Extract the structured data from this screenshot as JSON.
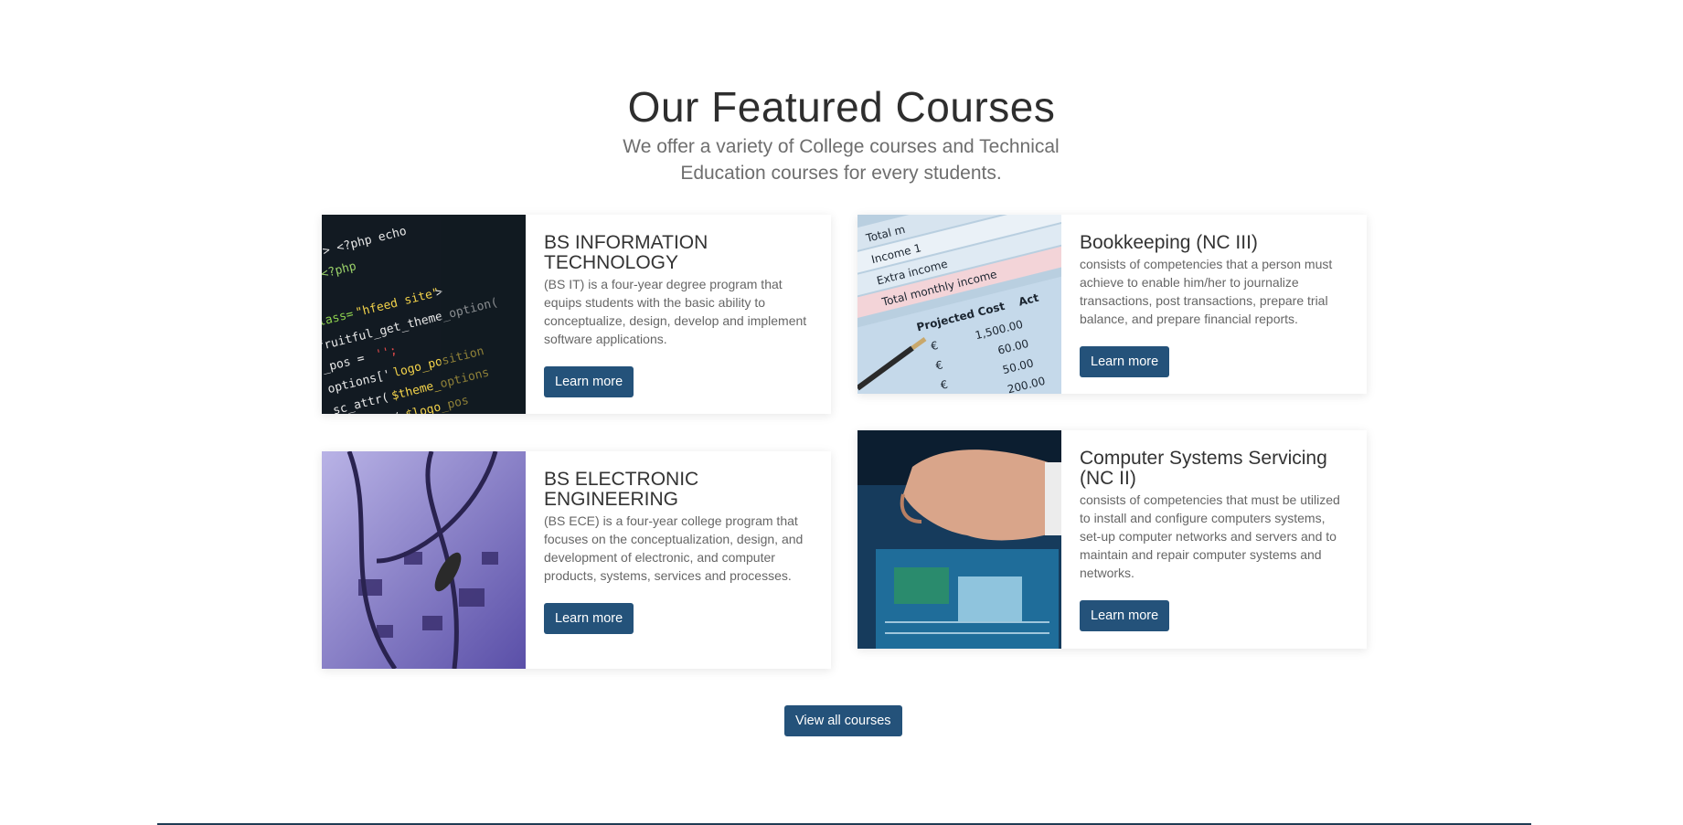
{
  "section": {
    "title": "Our Featured Courses",
    "subtitle": "We offer a variety of College courses and Technical Education courses for every students."
  },
  "courses": [
    {
      "title": "BS INFORMATION TECHNOLOGY",
      "description": "(BS IT) is a four-year degree program that equips students with the basic ability to conceptualize, design, develop and implement software applications.",
      "button": "Learn more",
      "image": "code-screen-photo"
    },
    {
      "title": "Bookkeeping (NC III)",
      "description": "consists of competencies that a person must achieve to enable him/her to journalize transactions, post transactions, prepare trial balance, and prepare financial reports.",
      "button": "Learn more",
      "image": "financial-sheet-photo"
    },
    {
      "title": "BS ELECTRONIC ENGINEERING",
      "description": "(BS ECE) is a four-year college program that focuses on the conceptualization, design, and development of electronic, and computer products, systems, services and processes.",
      "button": "Learn more",
      "image": "circuit-board-photo"
    },
    {
      "title": "Computer Systems Servicing (NC II)",
      "description": "consists of competencies that must be utilized to install and configure computers systems, set-up computer networks and servers and to maintain and repair computer systems and networks.",
      "button": "Learn more",
      "image": "computer-repair-photo"
    }
  ],
  "view_all_label": "View all courses",
  "colors": {
    "button": "#24527a",
    "footer_bar": "#1f3b54"
  }
}
